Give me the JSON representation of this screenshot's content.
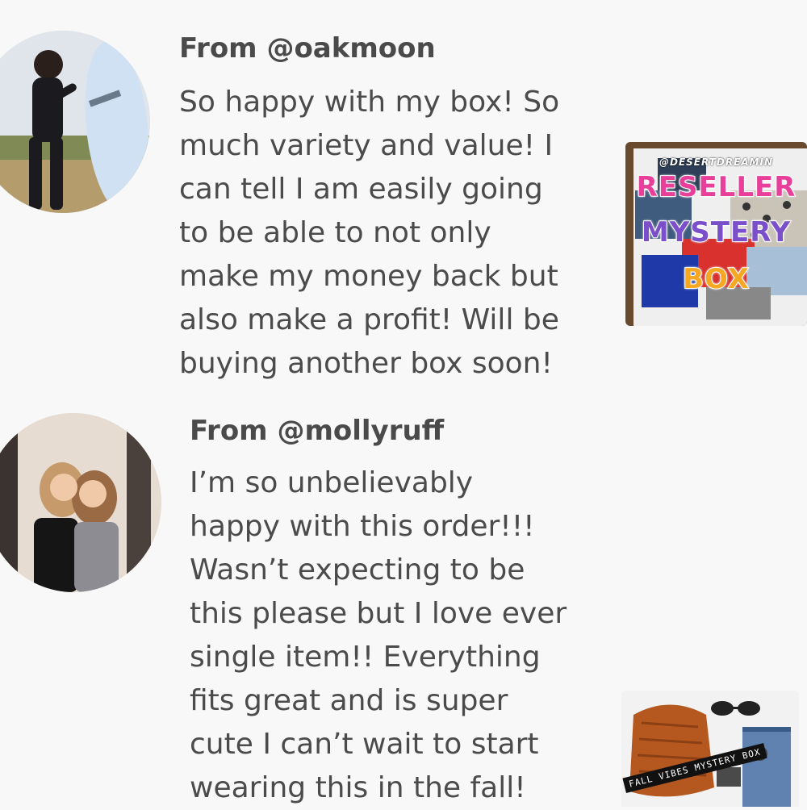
{
  "reviews": [
    {
      "username": "From @oakmoon",
      "text": "So happy with my box! So\nmuch variety and value! I\ncan tell I am easily going\nto be able to not only\nmake my money back but\nalso make a profit! Will be\nbuying another box soon!",
      "thumb": {
        "handle": "@DESERTDREAMIN",
        "words": [
          "RESELLER",
          "MYSTERY",
          "BOX"
        ]
      }
    },
    {
      "username": "From @mollyruff",
      "text": "I’m so unbelievably\nhappy with this order!!!\nWasn’t expecting to be\nthis please but I love ever\nsingle item!! Everything\nfits great and is super\ncute I can’t wait to start\nwearing this in the fall!",
      "thumb": {
        "banner": "FALL VIBES MYSTERY BOX"
      }
    }
  ],
  "colors": {
    "background": "#f8f8f8",
    "text": "#4b4b4b",
    "word_gradient": [
      "#e8409a",
      "#f7a823",
      "#3fb8e8",
      "#7b4fc9"
    ]
  }
}
